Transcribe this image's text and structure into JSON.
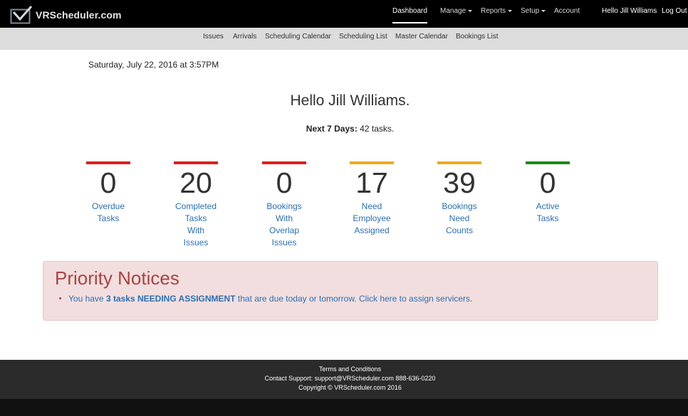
{
  "navbar": {
    "brand": "VRScheduler.com",
    "logo_icon": "checkmark-box-icon",
    "items": [
      {
        "label": "Dashboard",
        "active": true,
        "dropdown": false
      },
      {
        "label": "Manage",
        "active": false,
        "dropdown": true
      },
      {
        "label": "Reports",
        "active": false,
        "dropdown": true
      },
      {
        "label": "Setup",
        "active": false,
        "dropdown": true
      },
      {
        "label": "Account",
        "active": false,
        "dropdown": false
      }
    ],
    "user_greeting": "Hello Jill Williams",
    "logout": "Log Out"
  },
  "subnav": {
    "items": [
      "Issues",
      "Arrivals",
      "Scheduling Calendar",
      "Scheduling List",
      "Master Calendar",
      "Bookings List"
    ]
  },
  "main": {
    "date": "Saturday, July 22, 2016 at 3:57PM",
    "hello": "Hello Jill Williams.",
    "next7_label": "Next 7 Days:",
    "next7_value": "42 tasks."
  },
  "stats": [
    {
      "value": "0",
      "lines": [
        "Overdue",
        "Tasks"
      ],
      "color": "#e01e1e"
    },
    {
      "value": "20",
      "lines": [
        "Completed",
        "Tasks",
        "With",
        "Issues"
      ],
      "color": "#e01e1e"
    },
    {
      "value": "0",
      "lines": [
        "Bookings",
        "With",
        "Overlap",
        "Issues"
      ],
      "color": "#e01e1e"
    },
    {
      "value": "17",
      "lines": [
        "Need",
        "Employee",
        "Assigned"
      ],
      "color": "#f0a91a"
    },
    {
      "value": "39",
      "lines": [
        "Bookings",
        "Need",
        "Counts"
      ],
      "color": "#f0a91a"
    },
    {
      "value": "0",
      "lines": [
        "Active",
        "Tasks"
      ],
      "color": "#1a8a1a"
    }
  ],
  "priority": {
    "title": "Priority Notices",
    "item_prefix": "You have",
    "item_bold": "3 tasks NEEDING ASSIGNMENT",
    "item_suffix": "that are due today or tomorrow. Click here to assign servicers."
  },
  "footer": {
    "terms": "Terms and Conditions",
    "support": "Contact Support: support@VRScheduler.com 888-636-0220",
    "copyright": "Copyright © VRScheduler.com 2016"
  }
}
